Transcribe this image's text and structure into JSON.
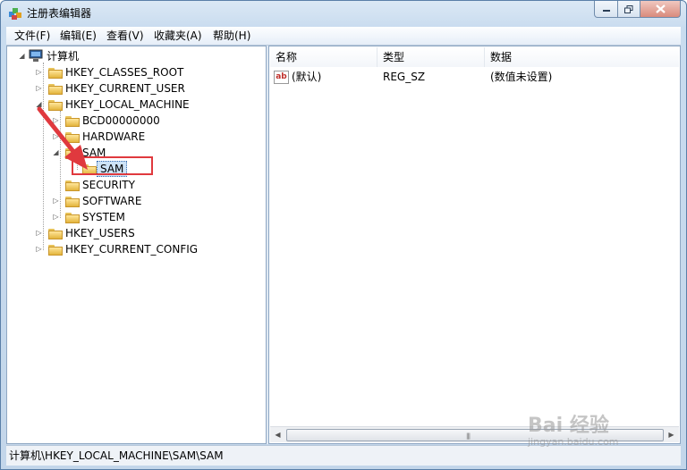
{
  "window": {
    "title": "注册表编辑器"
  },
  "menu": [
    "文件(F)",
    "编辑(E)",
    "查看(V)",
    "收藏夹(A)",
    "帮助(H)"
  ],
  "tree": {
    "root": "计算机",
    "items": [
      {
        "label": "HKEY_CLASSES_ROOT"
      },
      {
        "label": "HKEY_CURRENT_USER"
      },
      {
        "label": "HKEY_LOCAL_MACHINE"
      },
      {
        "label": "BCD00000000"
      },
      {
        "label": "HARDWARE"
      },
      {
        "label": "SAM"
      },
      {
        "label": "SAM"
      },
      {
        "label": "SECURITY"
      },
      {
        "label": "SOFTWARE"
      },
      {
        "label": "SYSTEM"
      },
      {
        "label": "HKEY_USERS"
      },
      {
        "label": "HKEY_CURRENT_CONFIG"
      }
    ]
  },
  "list": {
    "columns": [
      "名称",
      "类型",
      "数据"
    ],
    "rows": [
      {
        "name": "(默认)",
        "type": "REG_SZ",
        "data": "(数值未设置)",
        "icon": "ab-string-icon"
      }
    ]
  },
  "status": {
    "path": "计算机\\HKEY_LOCAL_MACHINE\\SAM\\SAM"
  },
  "watermark": {
    "brand": "Bai 经验",
    "url": "jingyan.baidu.com"
  },
  "colors": {
    "annotation": "#e0393e",
    "selection": "#cde3f7"
  }
}
